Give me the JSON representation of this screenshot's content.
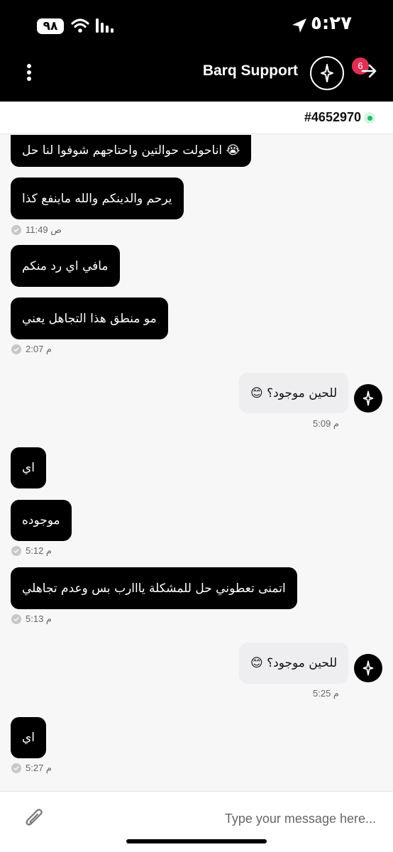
{
  "status_bar": {
    "time": "٥:٢٧",
    "battery": "٩٨"
  },
  "header": {
    "title": "Barq Support",
    "badge_count": "6"
  },
  "ticket": {
    "id": "#4652970"
  },
  "messages": [
    {
      "side": "user",
      "text": "😭 اناحولت حوالتين واحتاجهم شوفوا لنا حل"
    },
    {
      "side": "user",
      "text": "يرحم والدينكم والله ماينفع كذا",
      "time": "11:49 ص"
    },
    {
      "side": "user",
      "text": "مافي اي رد منكم"
    },
    {
      "side": "user",
      "text": "مو منطق هذا التجاهل يعني",
      "time": "2:07 م"
    },
    {
      "side": "agent",
      "text": "للحين موجود؟ 😊",
      "time": "5:09 م"
    },
    {
      "side": "user",
      "text": "اي"
    },
    {
      "side": "user",
      "text": "موجوده",
      "time": "5:12 م"
    },
    {
      "side": "user",
      "text": "اتمنى تعطوني حل للمشكلة يااارب بس وعدم تجاهلي",
      "time": "5:13 م"
    },
    {
      "side": "agent",
      "text": "للحين موجود؟ 😊",
      "time": "5:25 م"
    },
    {
      "side": "user",
      "text": "اي",
      "time": "5:27 م"
    }
  ],
  "composer": {
    "placeholder": "Type your message here..."
  },
  "colors": {
    "user_bubble": "#000000",
    "agent_bubble": "#eeeef1",
    "badge": "#e02f52",
    "online": "#1dbb6b"
  }
}
